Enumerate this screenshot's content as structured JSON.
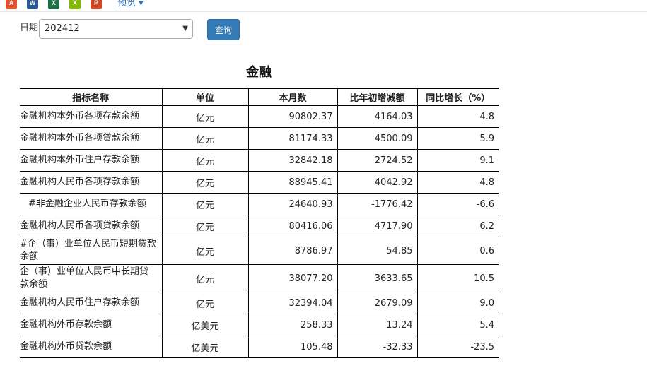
{
  "toolbar": {
    "preview_label": "预览 ▾",
    "icons": [
      "pdf-icon",
      "word-icon",
      "excel-icon",
      "excel-green-icon",
      "powerpoint-icon"
    ],
    "icon_glyphs": [
      "A",
      "W",
      "X",
      "X",
      "P"
    ],
    "icon_colors": [
      "#e2522c",
      "#2b5797",
      "#1e7145",
      "#7fba00",
      "#d24726"
    ]
  },
  "filter": {
    "date_label": "日期",
    "date_value": "202412",
    "query_label": "查询"
  },
  "table": {
    "title": "金融",
    "headers": [
      "指标名称",
      "单位",
      "本月数",
      "比年初增减额",
      "同比增长（%）"
    ],
    "rows": [
      {
        "name": "金融机构本外币各项存款余额",
        "unit": "亿元",
        "current": "90802.37",
        "change": "4164.03",
        "yoy": "4.8"
      },
      {
        "name": "金融机构本外币各项贷款余额",
        "unit": "亿元",
        "current": "81174.33",
        "change": "4500.09",
        "yoy": "5.9"
      },
      {
        "name": "金融机构本外币住户存款余额",
        "unit": "亿元",
        "current": "32842.18",
        "change": "2724.52",
        "yoy": "9.1"
      },
      {
        "name": "金融机构人民币各项存款余额",
        "unit": "亿元",
        "current": "88945.41",
        "change": "4042.92",
        "yoy": "4.8"
      },
      {
        "name": "#非金融企业人民币存款余额",
        "unit": "亿元",
        "current": "24640.93",
        "change": "-1776.42",
        "yoy": "-6.6"
      },
      {
        "name": "金融机构人民币各项贷款余额",
        "unit": "亿元",
        "current": "80416.06",
        "change": "4717.90",
        "yoy": "6.2"
      },
      {
        "name": "#企（事）业单位人民币短期贷款余额",
        "unit": "亿元",
        "current": "8786.97",
        "change": "54.85",
        "yoy": "0.6"
      },
      {
        "name": "企（事）业单位人民币中长期贷款余额",
        "unit": "亿元",
        "current": "38077.20",
        "change": "3633.65",
        "yoy": "10.5"
      },
      {
        "name": "金融机构人民币住户存款余额",
        "unit": "亿元",
        "current": "32394.04",
        "change": "2679.09",
        "yoy": "9.0"
      },
      {
        "name": "金融机构外币存款余额",
        "unit": "亿美元",
        "current": "258.33",
        "change": "13.24",
        "yoy": "5.4"
      },
      {
        "name": "金融机构外币贷款余额",
        "unit": "亿美元",
        "current": "105.48",
        "change": "-32.33",
        "yoy": "-23.5"
      }
    ]
  }
}
